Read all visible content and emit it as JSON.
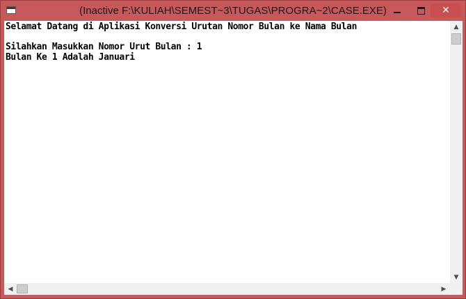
{
  "window": {
    "title": "(Inactive F:\\KULIAH\\SEMEST~3\\TUGAS\\PROGRA~2\\CASE.EXE)",
    "accent_color": "#c8595a"
  },
  "controls": {
    "minimize_icon": "minimize-icon",
    "maximize_icon": "maximize-icon",
    "close_icon": "close-icon",
    "close_glyph": "✕"
  },
  "console": {
    "lines": [
      "Selamat Datang di Aplikasi Konversi Urutan Nomor Bulan ke Nama Bulan",
      "",
      "Silahkan Masukkan Nomor Urut Bulan : 1",
      "Bulan Ke 1 Adalah Januari"
    ]
  },
  "scrollbars": {
    "up_glyph": "▲",
    "down_glyph": "▼",
    "left_glyph": "◀",
    "right_glyph": "▶"
  }
}
